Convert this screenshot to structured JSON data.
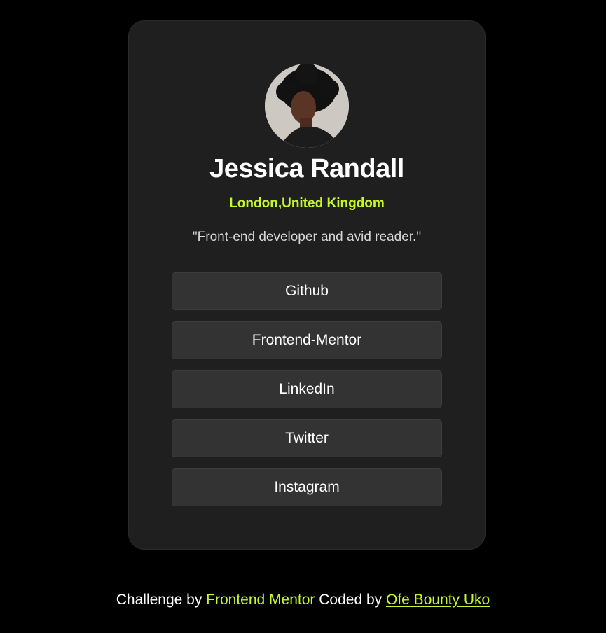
{
  "profile": {
    "name": "Jessica Randall",
    "location": "London,United Kingdom",
    "bio": "\"Front-end developer and avid reader.\"",
    "avatar_icon": "profile-photo"
  },
  "links": [
    {
      "label": "Github"
    },
    {
      "label": "Frontend-Mentor"
    },
    {
      "label": "LinkedIn"
    },
    {
      "label": "Twitter"
    },
    {
      "label": "Instagram"
    }
  ],
  "footer": {
    "prefix": "Challenge by ",
    "mentor_link": "Frontend Mentor",
    "middle": " Coded by ",
    "author_link": "Ofe Bounty Uko"
  },
  "colors": {
    "background": "#000000",
    "card": "#1f1f1f",
    "accent": "#c4f82a",
    "button": "#333333",
    "text": "#ffffff"
  }
}
